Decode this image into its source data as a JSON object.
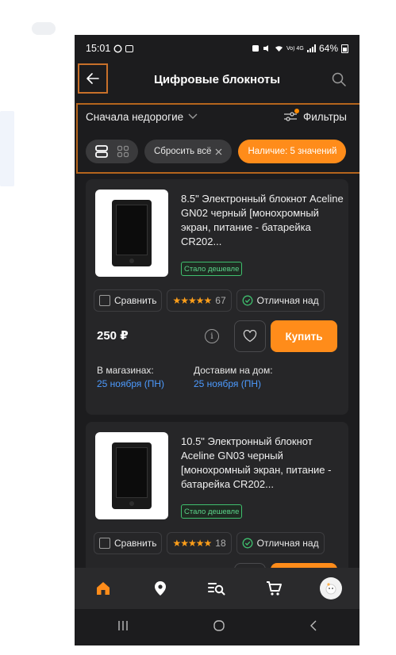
{
  "status_bar": {
    "time": "15:01",
    "signal_text": "Vo) 4G LTE",
    "battery": "64%"
  },
  "header": {
    "title": "Цифровые блокноты"
  },
  "sort": {
    "label": "Сначала недорогие"
  },
  "filters": {
    "label": "Фильтры"
  },
  "chips": {
    "reset": "Сбросить всё",
    "availability": "Наличие: 5 значений"
  },
  "products": [
    {
      "name": "8.5\" Электронный блокнот Aceline GN02 черный [монохромный экран, питание - батарейка CR202...",
      "badge": "Стало дешевле",
      "compare": "Сравнить",
      "rating_stars": "★★★★★",
      "rating_count": "67",
      "reliability": "Отличная над",
      "price": "250 ₽",
      "buy": "Купить",
      "in_stores_label": "В магазинах:",
      "in_stores_date": "25 ноября (ПН)",
      "delivery_label": "Доставим на дом:",
      "delivery_date": "25 ноября (ПН)"
    },
    {
      "name": "10.5\" Электронный блокнот Aceline GN03 черный [монохромный экран, питание - батарейка CR202...",
      "badge": "Стало дешевле",
      "compare": "Сравнить",
      "rating_stars": "★★★★★",
      "rating_count": "18",
      "reliability": "Отличная над"
    }
  ],
  "colors": {
    "accent": "#ff8c1a",
    "background": "#1c1c1e",
    "card": "#262628",
    "link": "#4d9bff",
    "badge_green": "#3fbf6e"
  }
}
